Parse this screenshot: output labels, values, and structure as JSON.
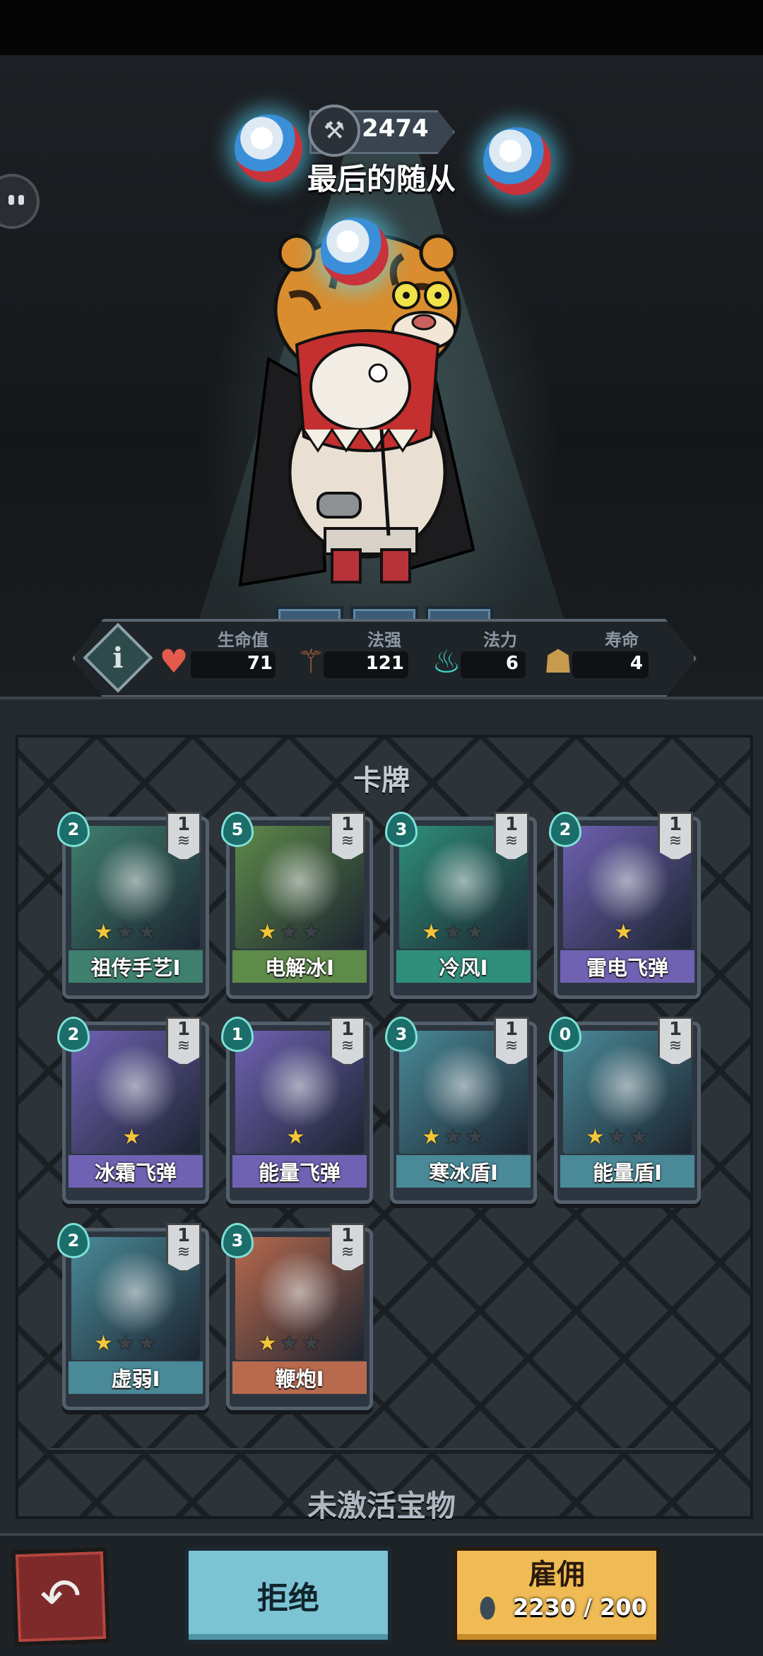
{
  "header": {
    "score": "2474",
    "minion_name": "最后的随从"
  },
  "stats": {
    "hp_label": "生命值",
    "hp_value": "71",
    "spell_power_label": "法强",
    "spell_power_value": "121",
    "mana_label": "法力",
    "mana_value": "6",
    "lifespan_label": "寿命",
    "lifespan_value": "4"
  },
  "cards_section": {
    "title": "卡牌",
    "cards": [
      {
        "name": "祖传手艺I",
        "cost": "2",
        "level": "1",
        "stars": 1,
        "max_stars": 3,
        "theme": "#3f7f6e"
      },
      {
        "name": "电解冰I",
        "cost": "5",
        "level": "1",
        "stars": 1,
        "max_stars": 3,
        "theme": "#5e8a4a"
      },
      {
        "name": "冷风I",
        "cost": "3",
        "level": "1",
        "stars": 1,
        "max_stars": 3,
        "theme": "#2f8f7a"
      },
      {
        "name": "雷电飞弹",
        "cost": "2",
        "level": "1",
        "stars": 1,
        "max_stars": 1,
        "theme": "#7062b3"
      },
      {
        "name": "冰霜飞弹",
        "cost": "2",
        "level": "1",
        "stars": 1,
        "max_stars": 1,
        "theme": "#7062b3"
      },
      {
        "name": "能量飞弹",
        "cost": "1",
        "level": "1",
        "stars": 1,
        "max_stars": 1,
        "theme": "#7062b3"
      },
      {
        "name": "寒冰盾I",
        "cost": "3",
        "level": "1",
        "stars": 1,
        "max_stars": 3,
        "theme": "#4a8a98"
      },
      {
        "name": "能量盾I",
        "cost": "0",
        "level": "1",
        "stars": 1,
        "max_stars": 3,
        "theme": "#4a8a98"
      },
      {
        "name": "虚弱I",
        "cost": "2",
        "level": "1",
        "stars": 1,
        "max_stars": 3,
        "theme": "#4a8a98"
      },
      {
        "name": "鞭炮I",
        "cost": "3",
        "level": "1",
        "stars": 1,
        "max_stars": 3,
        "theme": "#b86a4e"
      }
    ]
  },
  "inactive_section": {
    "title": "未激活宝物"
  },
  "actions": {
    "reject_label": "拒绝",
    "hire_label": "雇佣",
    "hire_cost": "2230 / 200"
  },
  "colors": {
    "reject": "#7cc4d4",
    "hire": "#f0bb55",
    "back": "#7e2a2a"
  }
}
